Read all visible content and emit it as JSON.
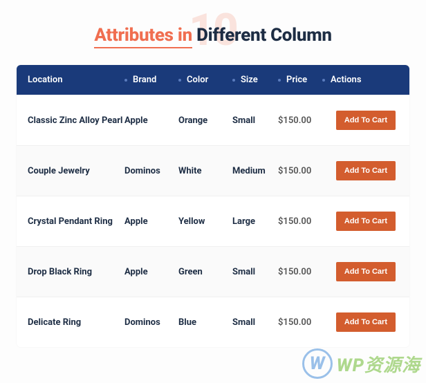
{
  "heading": {
    "bg_number": "10",
    "accent": "Attributes in",
    "rest": " Different Column"
  },
  "columns": {
    "location": "Location",
    "brand": "Brand",
    "color": "Color",
    "size": "Size",
    "price": "Price",
    "actions": "Actions"
  },
  "rows": [
    {
      "location": "Classic Zinc Alloy Pearl",
      "brand": "Apple",
      "color": "Orange",
      "size": "Small",
      "price": "$150.00",
      "action": "Add To Cart"
    },
    {
      "location": "Couple Jewelry",
      "brand": "Dominos",
      "color": "White",
      "size": "Medium",
      "price": "$150.00",
      "action": "Add To Cart"
    },
    {
      "location": "Crystal Pendant Ring",
      "brand": "Apple",
      "color": "Yellow",
      "size": "Large",
      "price": "$150.00",
      "action": "Add To Cart"
    },
    {
      "location": "Drop Black Ring",
      "brand": "Apple",
      "color": "Green",
      "size": "Small",
      "price": "$150.00",
      "action": "Add To Cart"
    },
    {
      "location": "Delicate Ring",
      "brand": "Dominos",
      "color": "Blue",
      "size": "Small",
      "price": "$150.00",
      "action": "Add To Cart"
    }
  ],
  "watermark": {
    "w": "W",
    "text": "WP资源海"
  },
  "colors": {
    "accent": "#f06e50",
    "header": "#1a3a7a",
    "button": "#d35d2e"
  }
}
